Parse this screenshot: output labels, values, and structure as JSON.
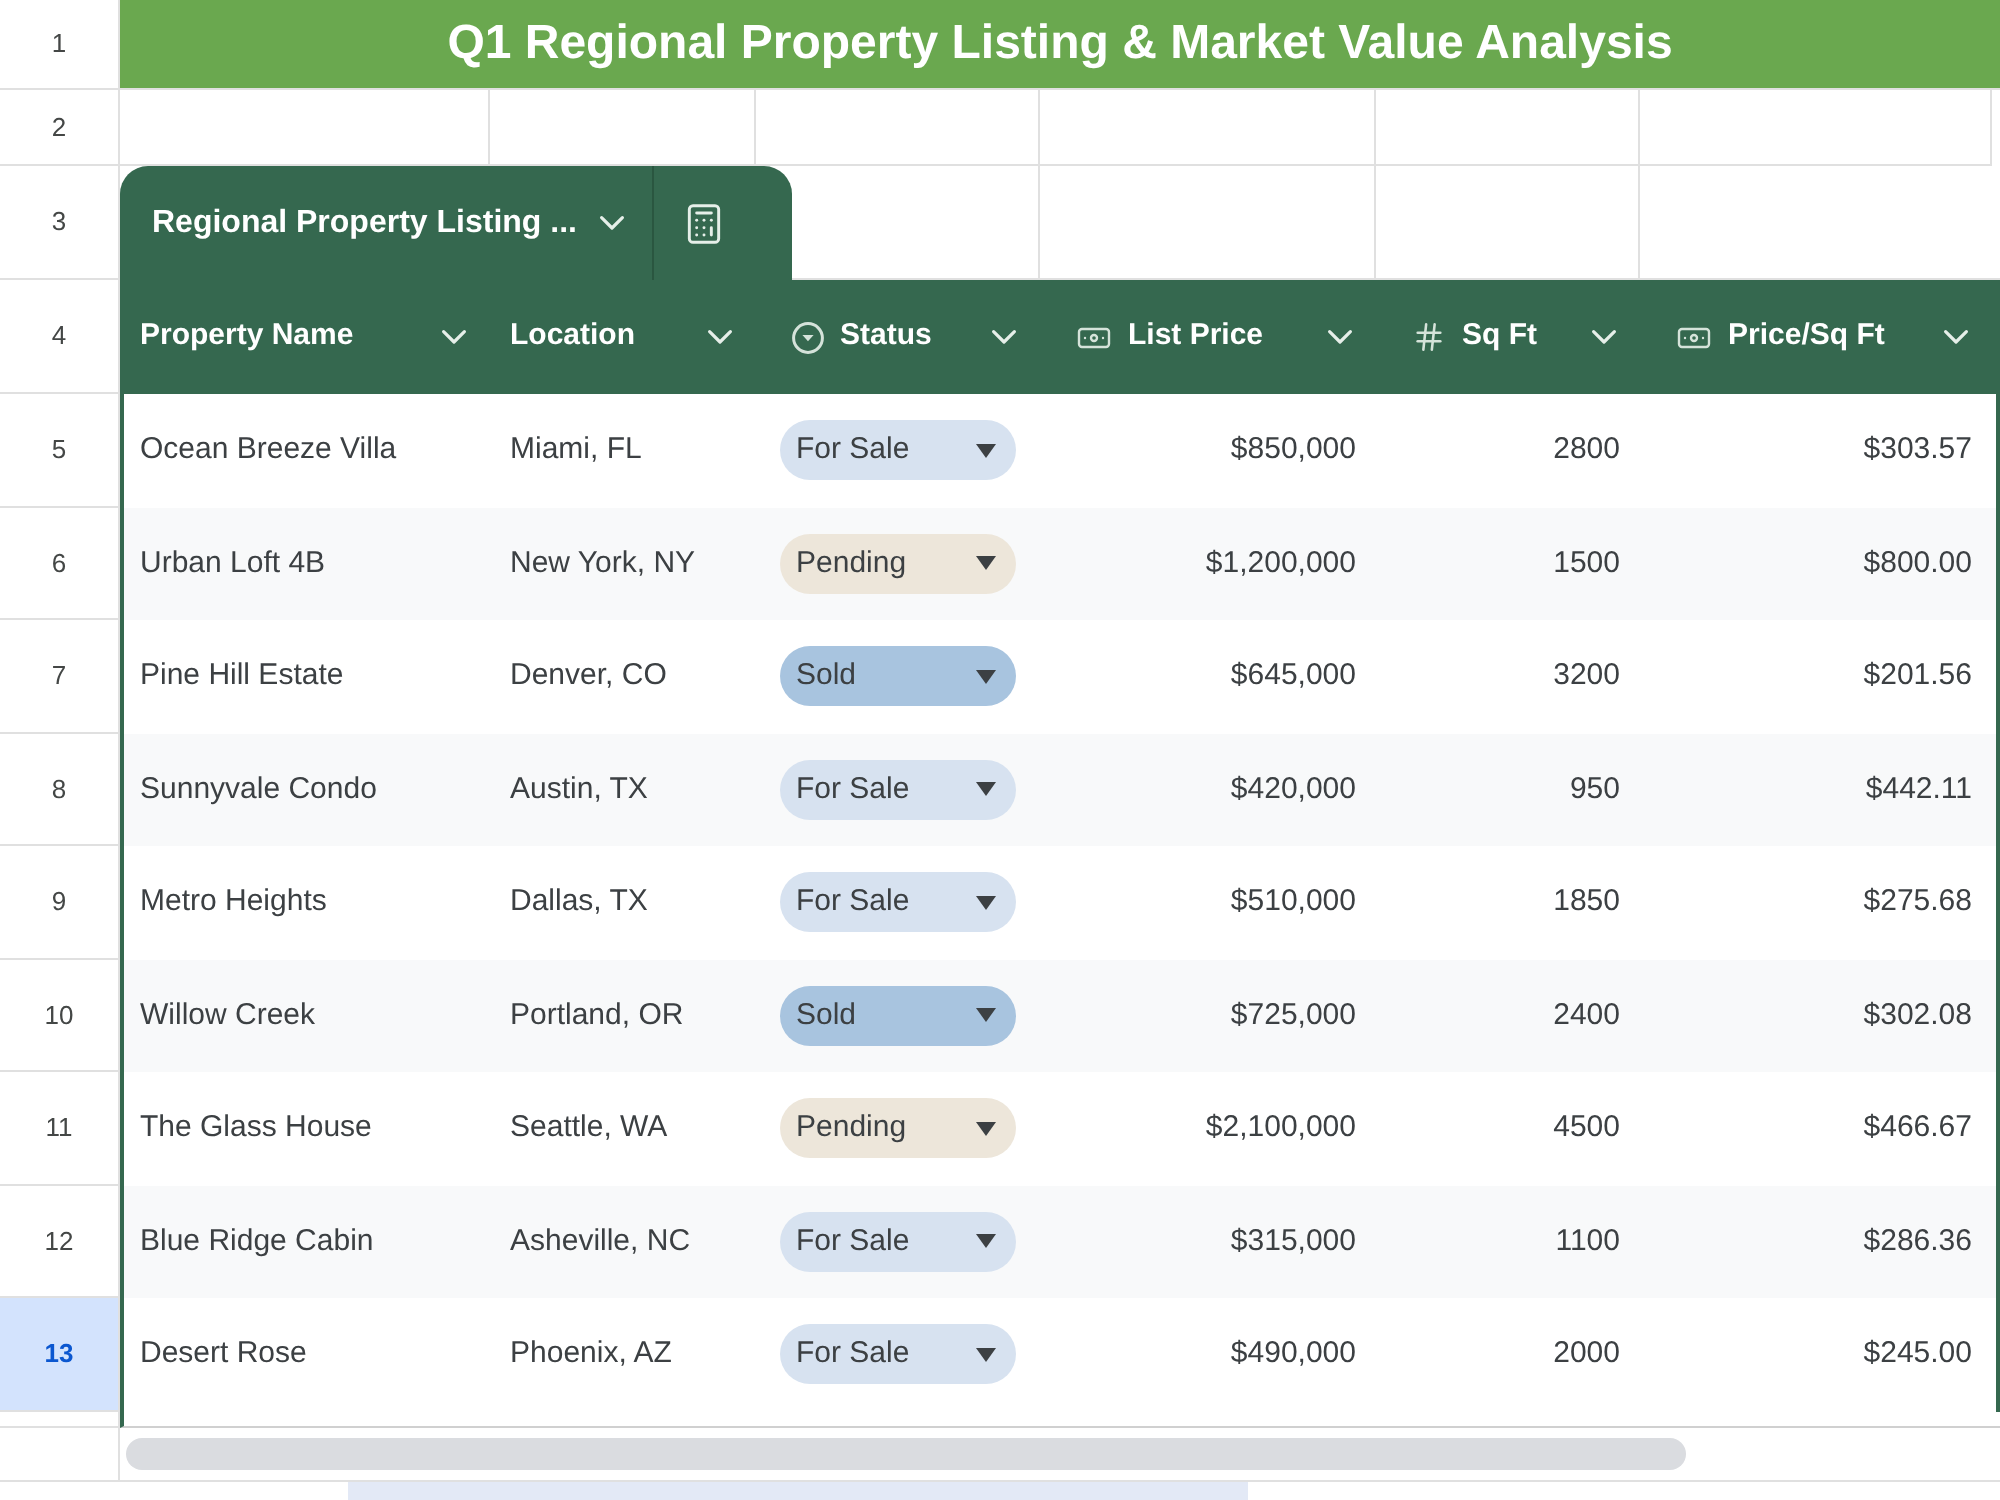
{
  "title": "Q1 Regional Property Listing & Market Value Analysis",
  "row_headers": [
    {
      "label": "1",
      "selected": false
    },
    {
      "label": "2",
      "selected": false
    },
    {
      "label": "3",
      "selected": false
    },
    {
      "label": "4",
      "selected": false
    },
    {
      "label": "5",
      "selected": false
    },
    {
      "label": "6",
      "selected": false
    },
    {
      "label": "7",
      "selected": false
    },
    {
      "label": "8",
      "selected": false
    },
    {
      "label": "9",
      "selected": false
    },
    {
      "label": "10",
      "selected": false
    },
    {
      "label": "11",
      "selected": false
    },
    {
      "label": "12",
      "selected": false
    },
    {
      "label": "13",
      "selected": true
    }
  ],
  "table": {
    "name": "Regional Property Listing ...",
    "columns": [
      {
        "label": "Property Name",
        "kind": "text"
      },
      {
        "label": "Location",
        "kind": "text"
      },
      {
        "label": "Status",
        "kind": "dropdown"
      },
      {
        "label": "List Price",
        "kind": "currency"
      },
      {
        "label": "Sq Ft",
        "kind": "number"
      },
      {
        "label": "Price/Sq Ft",
        "kind": "currency"
      }
    ],
    "rows": [
      {
        "property_name": "Ocean Breeze Villa",
        "location": "Miami, FL",
        "status": {
          "label": "For Sale",
          "color": "#d7e2f0"
        },
        "list_price": "$850,000",
        "sq_ft": "2800",
        "price_per_sq_ft": "$303.57"
      },
      {
        "property_name": "Urban Loft 4B",
        "location": "New York, NY",
        "status": {
          "label": "Pending",
          "color": "#ede6da"
        },
        "list_price": "$1,200,000",
        "sq_ft": "1500",
        "price_per_sq_ft": "$800.00"
      },
      {
        "property_name": "Pine Hill Estate",
        "location": "Denver, CO",
        "status": {
          "label": "Sold",
          "color": "#a8c4df"
        },
        "list_price": "$645,000",
        "sq_ft": "3200",
        "price_per_sq_ft": "$201.56"
      },
      {
        "property_name": "Sunnyvale Condo",
        "location": "Austin, TX",
        "status": {
          "label": "For Sale",
          "color": "#d7e2f0"
        },
        "list_price": "$420,000",
        "sq_ft": "950",
        "price_per_sq_ft": "$442.11"
      },
      {
        "property_name": "Metro Heights",
        "location": "Dallas, TX",
        "status": {
          "label": "For Sale",
          "color": "#d7e2f0"
        },
        "list_price": "$510,000",
        "sq_ft": "1850",
        "price_per_sq_ft": "$275.68"
      },
      {
        "property_name": "Willow Creek",
        "location": "Portland, OR",
        "status": {
          "label": "Sold",
          "color": "#a8c4df"
        },
        "list_price": "$725,000",
        "sq_ft": "2400",
        "price_per_sq_ft": "$302.08"
      },
      {
        "property_name": "The Glass House",
        "location": "Seattle, WA",
        "status": {
          "label": "Pending",
          "color": "#ede6da"
        },
        "list_price": "$2,100,000",
        "sq_ft": "4500",
        "price_per_sq_ft": "$466.67"
      },
      {
        "property_name": "Blue Ridge Cabin",
        "location": "Asheville, NC",
        "status": {
          "label": "For Sale",
          "color": "#d7e2f0"
        },
        "list_price": "$315,000",
        "sq_ft": "1100",
        "price_per_sq_ft": "$286.36"
      },
      {
        "property_name": "Desert Rose",
        "location": "Phoenix, AZ",
        "status": {
          "label": "For Sale",
          "color": "#d7e2f0"
        },
        "list_price": "$490,000",
        "sq_ft": "2000",
        "price_per_sq_ft": "$245.00"
      }
    ]
  }
}
